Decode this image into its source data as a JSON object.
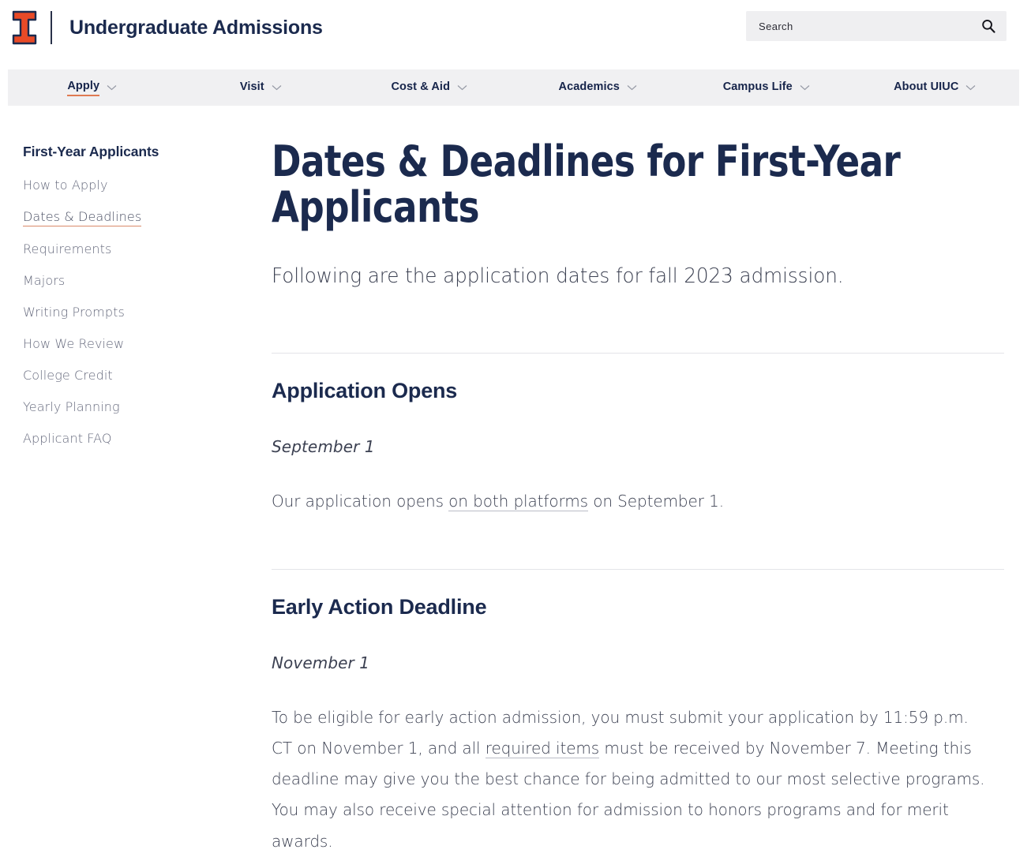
{
  "header": {
    "logo_icon": "illinois-block-i-logo",
    "logo_color": "#e84a27",
    "logo_outline_color": "#1b2a4e",
    "site_title": "Undergraduate Admissions",
    "search": {
      "placeholder": "Search",
      "value": "",
      "icon": "search-icon"
    }
  },
  "nav": {
    "accent_color": "#e07a52",
    "background": "#f0f0f2",
    "items": [
      {
        "label": "Apply",
        "active": true,
        "icon": "chevron-down-icon"
      },
      {
        "label": "Visit",
        "active": false,
        "icon": "chevron-down-icon"
      },
      {
        "label": "Cost & Aid",
        "active": false,
        "icon": "chevron-down-icon"
      },
      {
        "label": "Academics",
        "active": false,
        "icon": "chevron-down-icon"
      },
      {
        "label": "Campus Life",
        "active": false,
        "icon": "chevron-down-icon"
      },
      {
        "label": "About UIUC",
        "active": false,
        "icon": "chevron-down-icon"
      }
    ]
  },
  "sidebar": {
    "title": "First-Year Applicants",
    "items": [
      {
        "label": "How to Apply",
        "active": false
      },
      {
        "label": "Dates & Deadlines",
        "active": true
      },
      {
        "label": "Requirements",
        "active": false
      },
      {
        "label": "Majors",
        "active": false
      },
      {
        "label": "Writing Prompts",
        "active": false
      },
      {
        "label": "How We Review",
        "active": false
      },
      {
        "label": "College Credit",
        "active": false
      },
      {
        "label": "Yearly Planning",
        "active": false
      },
      {
        "label": "Applicant FAQ",
        "active": false
      }
    ]
  },
  "main": {
    "title": "Dates & Deadlines for First-Year Applicants",
    "intro": "Following are the application dates for fall 2023 admission.",
    "sections": [
      {
        "heading": "Application Opens",
        "date": "September 1",
        "body_before": "Our application opens ",
        "link_text": "on both platforms",
        "body_after": " on September 1."
      },
      {
        "heading": "Early Action Deadline",
        "date": "November 1",
        "body_before": "To be eligible for early action admission, you must submit your application by 11:59 p.m. CT on November 1, and all ",
        "link_text": "required items",
        "body_after": " must be received by November 7. Meeting this deadline may give you the best chance for being admitted to our most selective programs. You may also receive special attention for admission to honors programs and for merit awards."
      }
    ]
  }
}
